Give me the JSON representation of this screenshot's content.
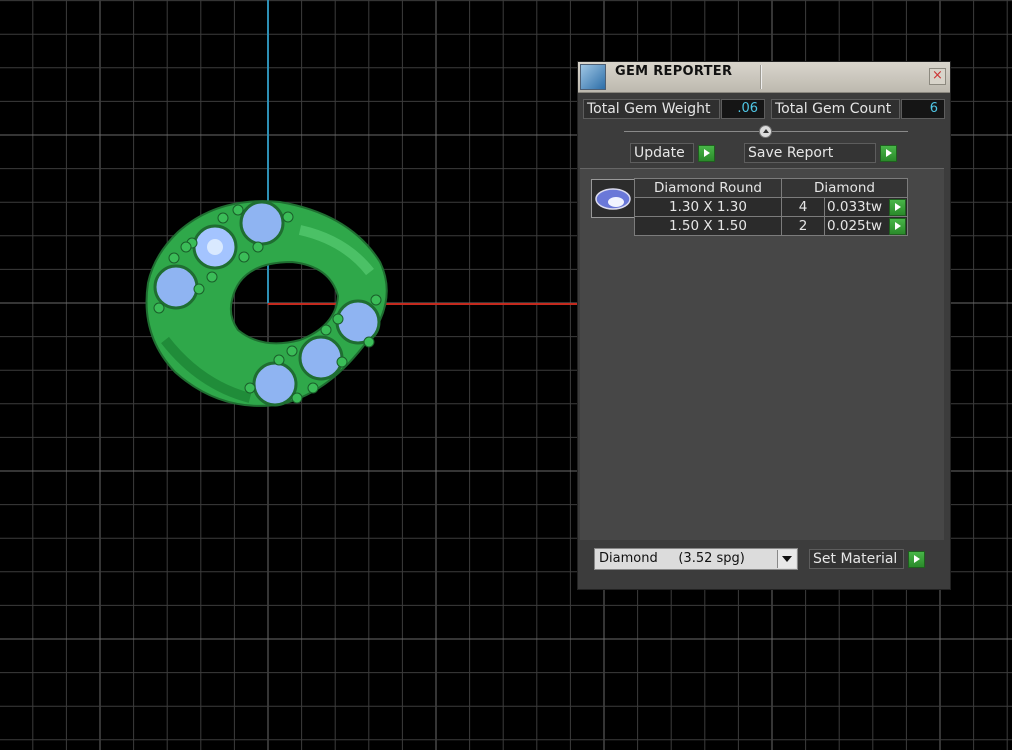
{
  "window": {
    "title": "GEM REPORTER",
    "close_glyph": "×",
    "icon": "gem-reporter-icon"
  },
  "summary": {
    "weight_label": "Total Gem Weight",
    "weight_value": ".06",
    "count_label": "Total Gem Count",
    "count_value": "6"
  },
  "actions": {
    "update_label": "Update",
    "save_label": "Save Report"
  },
  "gem_table": {
    "headers": [
      "Diamond Round",
      "Diamond"
    ],
    "rows": [
      {
        "size": "1.30 X 1.30",
        "count": "4",
        "weight": "0.033tw"
      },
      {
        "size": "1.50 X 1.50",
        "count": "2",
        "weight": "0.025tw"
      }
    ]
  },
  "material": {
    "selected": "Diamond     (3.52 spg)",
    "set_label": "Set Material"
  },
  "colors": {
    "ring_metal": "#2fa84a",
    "gem": "#8fb4f2",
    "axis_x": "#c42a1e",
    "axis_y": "#2d8fb4",
    "grid": "#4a4a4a",
    "value_text": "#4fc7e6",
    "go_button": "#2f9b2f"
  }
}
